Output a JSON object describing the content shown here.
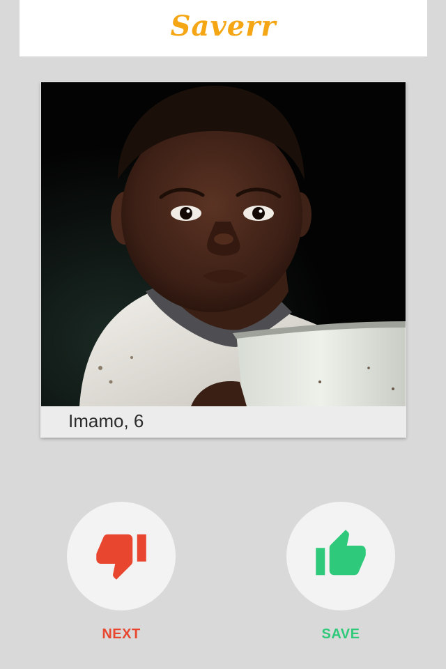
{
  "app": {
    "title": "Saverr"
  },
  "profile": {
    "caption": "Imamo, 6",
    "photo_icon": "child-portrait-photo"
  },
  "actions": {
    "next": {
      "label": "NEXT",
      "icon": "thumbs-down-icon",
      "color": "#e8462e"
    },
    "save": {
      "label": "SAVE",
      "icon": "thumbs-up-icon",
      "color": "#2ec97a"
    }
  },
  "colors": {
    "background": "#d8d9d8",
    "header_background": "#ffffff",
    "brand": "#f5a614",
    "caption_bar": "#ececec",
    "button_background": "#f3f3f3"
  }
}
